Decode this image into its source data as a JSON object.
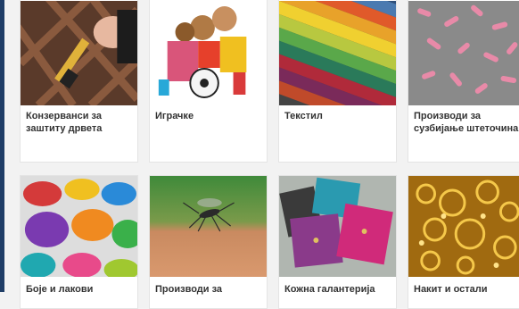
{
  "products": {
    "row1": [
      {
        "label": "Конзерванси за заштиту дрвета",
        "image_icon": "wood-preservative-brush-icon"
      },
      {
        "label": "Играчке",
        "image_icon": "toys-icon"
      },
      {
        "label": "Текстил",
        "image_icon": "textile-fabric-icon"
      },
      {
        "label": "Производи за сузбијање штеточина",
        "image_icon": "pest-control-pellets-icon"
      }
    ],
    "row2": [
      {
        "label": "Боје и лакови",
        "image_icon": "paint-cans-icon"
      },
      {
        "label": "Производи за",
        "image_icon": "mosquito-icon"
      },
      {
        "label": "Кожна галантерија",
        "image_icon": "leather-wallets-icon"
      },
      {
        "label": "Накит и остали",
        "image_icon": "gold-jewelry-icon"
      }
    ]
  },
  "colors": {
    "accent_edge": "#1f3d66",
    "card_bg": "#ffffff",
    "page_bg": "#f2f2f2",
    "label_text": "#333333"
  }
}
